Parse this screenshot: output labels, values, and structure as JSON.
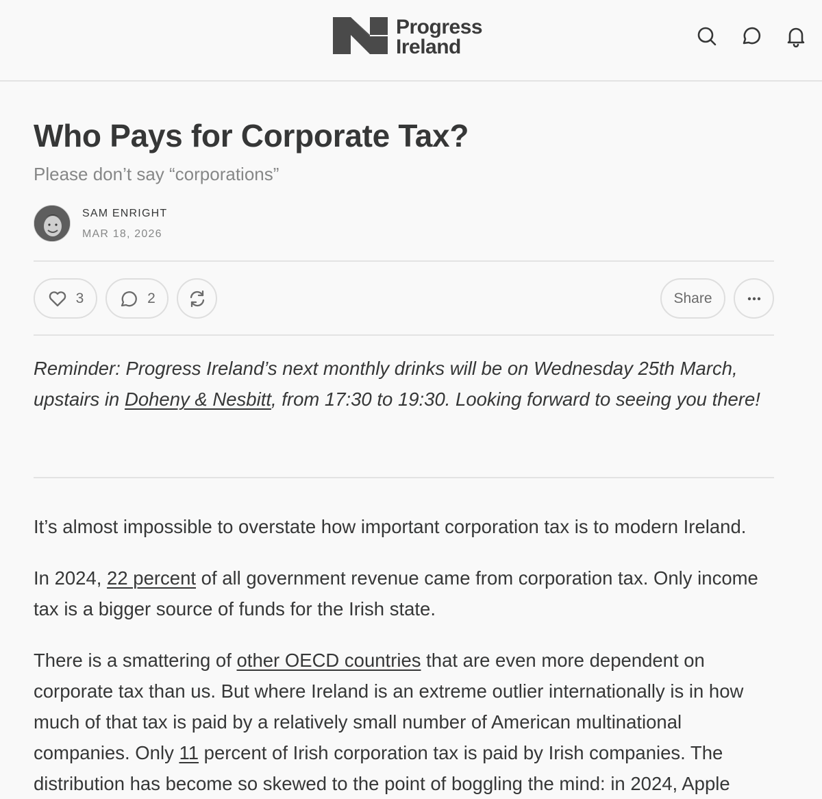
{
  "header": {
    "logo_line1": "Progress",
    "logo_line2": "Ireland",
    "icons": [
      "search-icon",
      "chat-icon",
      "bell-icon"
    ]
  },
  "post": {
    "title": "Who Pays for Corporate Tax?",
    "subtitle": "Please don’t say “corporations”",
    "author": "SAM ENRIGHT",
    "date": "MAR 18, 2026"
  },
  "actions": {
    "likes": "3",
    "comments": "2",
    "share_label": "Share"
  },
  "reminder": {
    "before": "Reminder: Progress Ireland’s next monthly drinks will be on Wednesday 25th March, upstairs in ",
    "link": "Doheny & Nesbitt",
    "after": ", from 17:30 to 19:30. Looking forward to seeing you there!"
  },
  "body": {
    "p1": "It’s almost impossible to overstate how important corporation tax is to modern Ireland.",
    "p2_before": "In 2024, ",
    "p2_link": "22 percent",
    "p2_after": " of all government revenue came from corporation tax. Only income tax is a bigger source of funds for the Irish state.",
    "p3_before": "There is a smattering of ",
    "p3_link1": "other OECD countries",
    "p3_mid": " that are even more dependent on corporate tax than us. But where Ireland is an extreme outlier internationally is in how much of that tax is paid by a relatively small number of American multinational companies. Only ",
    "p3_link2": "11",
    "p3_after": " percent of Irish corporation tax is paid by Irish companies. The distribution has become so skewed to the point of boggling the mind: in 2024, Apple"
  },
  "colors": {
    "background": "#f9f9f9",
    "text": "#363737",
    "muted": "#868787",
    "divider": "#e3e3e3",
    "logo": "#4a4a4a"
  }
}
